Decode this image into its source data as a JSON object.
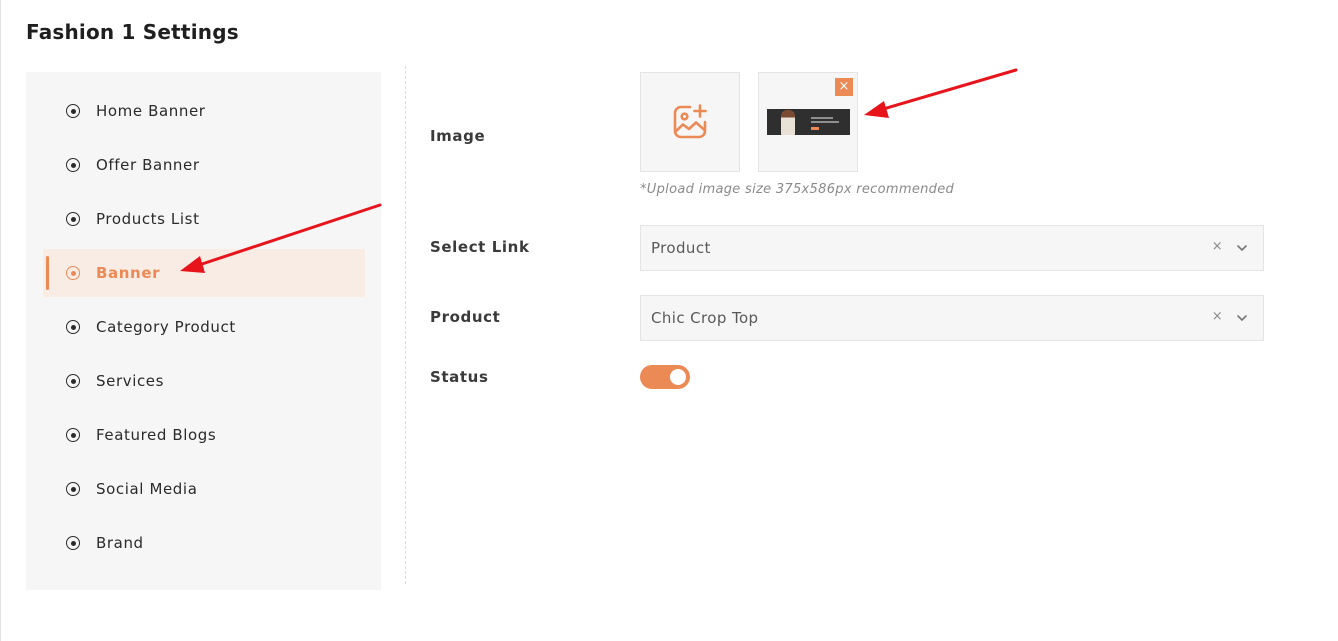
{
  "page": {
    "title": "Fashion 1 Settings"
  },
  "sidebar": {
    "items": [
      {
        "label": "Home Banner",
        "active": false
      },
      {
        "label": "Offer Banner",
        "active": false
      },
      {
        "label": "Products List",
        "active": false
      },
      {
        "label": "Banner",
        "active": true
      },
      {
        "label": "Category Product",
        "active": false
      },
      {
        "label": "Services",
        "active": false
      },
      {
        "label": "Featured Blogs",
        "active": false
      },
      {
        "label": "Social Media",
        "active": false
      },
      {
        "label": "Brand",
        "active": false
      }
    ]
  },
  "form": {
    "image": {
      "label": "Image",
      "upload_icon": "image-add-icon",
      "remove_icon": "close-icon",
      "remove_symbol": "×",
      "hint": "*Upload image size 375x586px recommended"
    },
    "select_link": {
      "label": "Select Link",
      "value": "Product",
      "clear_symbol": "×",
      "chevron_icon": "chevron-down-icon"
    },
    "product": {
      "label": "Product",
      "value": "Chic Crop Top",
      "clear_symbol": "×",
      "chevron_icon": "chevron-down-icon"
    },
    "status": {
      "label": "Status",
      "enabled": true
    }
  },
  "colors": {
    "accent": "#ec8a55",
    "active_bg": "#f9ece4",
    "panel_bg": "#f6f6f6",
    "annotation_arrow": "#e8141b"
  }
}
